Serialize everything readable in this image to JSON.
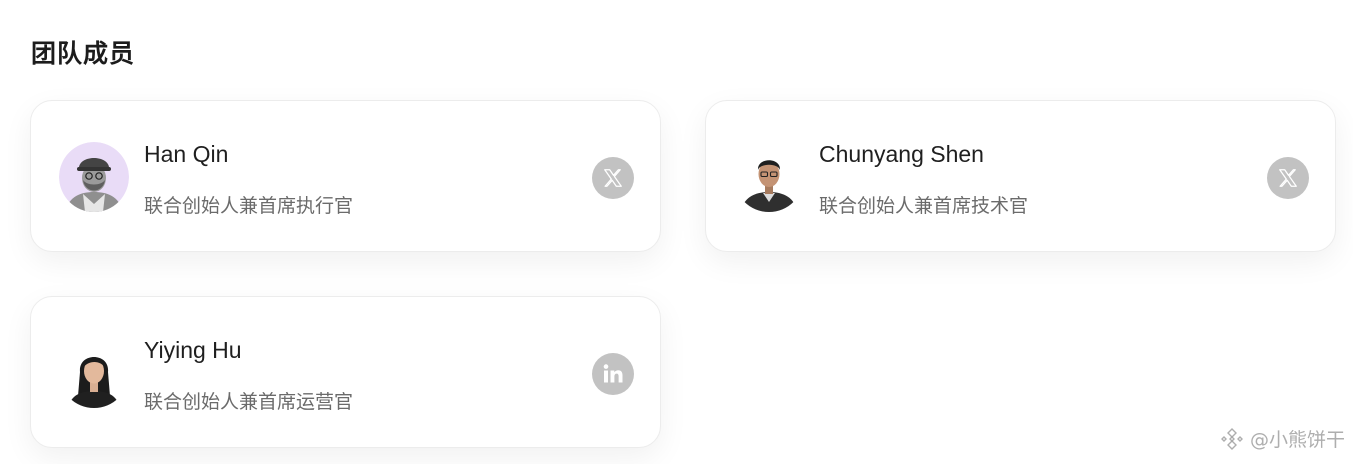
{
  "section": {
    "title": "团队成员"
  },
  "members": [
    {
      "name": "Han Qin",
      "role": "联合创始人兼首席执行官",
      "social_icon": "x-icon",
      "avatar_bg": "#e9dcf7"
    },
    {
      "name": "Chunyang Shen",
      "role": "联合创始人兼首席技术官",
      "social_icon": "x-icon",
      "avatar_bg": "#ffffff"
    },
    {
      "name": "Yiying Hu",
      "role": "联合创始人兼首席运营官",
      "social_icon": "linkedin-icon",
      "avatar_bg": "#ffffff"
    }
  ],
  "watermark": {
    "text": "@小熊饼干"
  },
  "colors": {
    "social_icon_bg": "#c2c2c2",
    "card_border": "#ececec",
    "role_text": "#6b6b6b"
  }
}
